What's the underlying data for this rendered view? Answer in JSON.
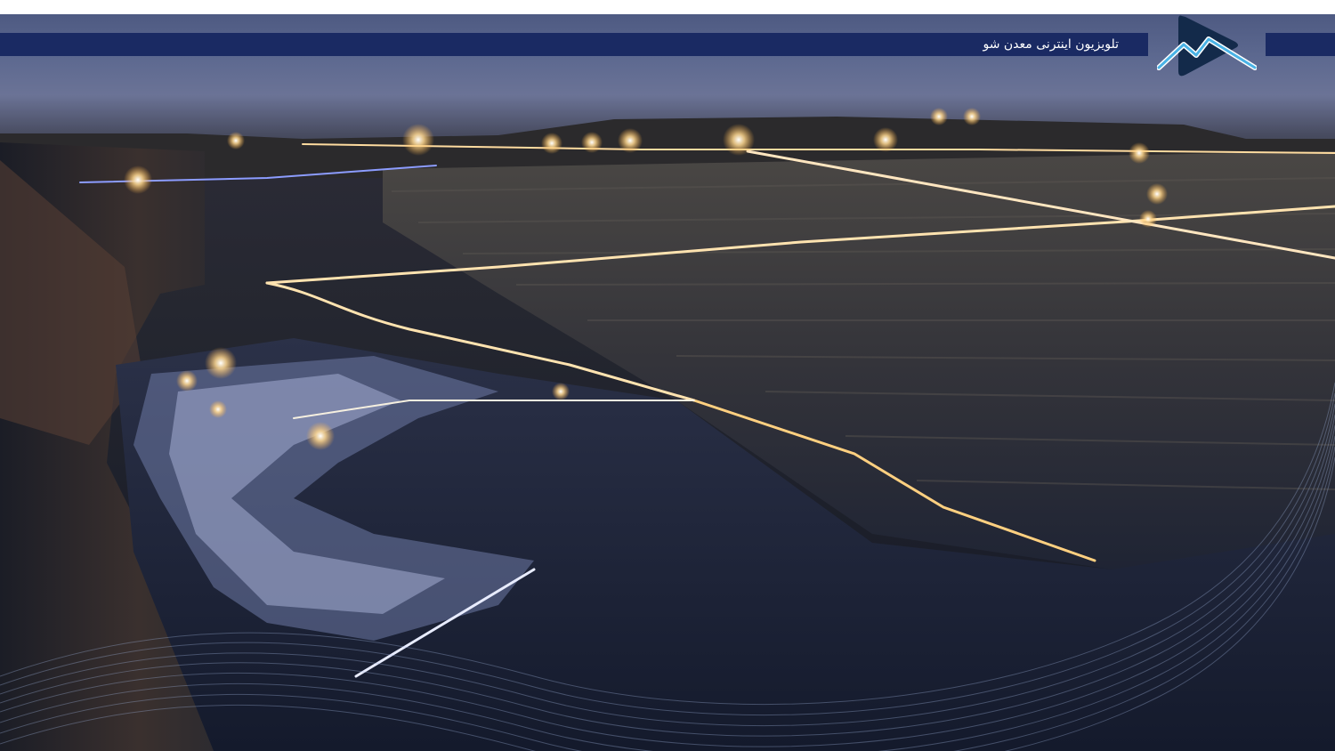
{
  "channel": {
    "caption": "تلویزیون اینترنی معدن شو",
    "logo_icon": "madanshow-mountain-play-logo"
  },
  "colors": {
    "band": "#1a2a63",
    "logo_triangle": "#132a4a",
    "logo_mountain": "#4ab3e6",
    "sky": "#5d6990",
    "lights": "#ffd890"
  },
  "scene": {
    "subject": "open-pit-mine-night-photo"
  }
}
